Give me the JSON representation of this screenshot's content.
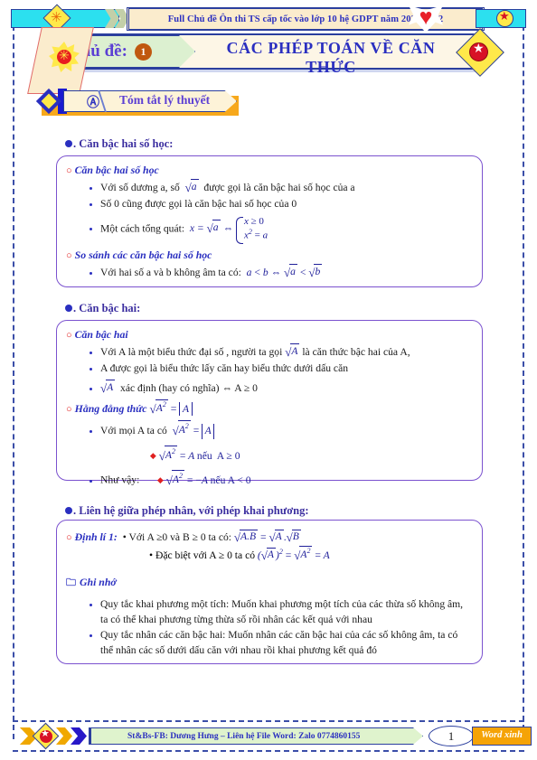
{
  "header": {
    "banner_text": "Full Chủ đề Ôn thi TS cấp tốc vào lớp 10 hệ GDPT năm 2021-2022",
    "heart_icon": "heart-icon",
    "left_burst_icon": "sunburst-icon",
    "right_star_icon": "flower-star-icon"
  },
  "title": {
    "prefix": "Chủ đề:",
    "number": "1",
    "main": "CÁC PHÉP TOÁN VỀ CĂN THỨC"
  },
  "section_a": {
    "letter": "Ⓐ",
    "label": "Tóm tắt lý thuyết"
  },
  "sections": [
    {
      "heading": ". Căn bậc hai số học:",
      "blocks": [
        {
          "marker": "○",
          "title": "Căn bậc hai số học",
          "items": [
            "Với số dương a, số √a được gọi là căn bậc hai số học của a",
            "Số 0 cũng được gọi là căn bậc hai số học của 0",
            "Một cách tổng quát: x = √a ⇔ { x ≥ 0 ; x² = a }"
          ]
        },
        {
          "marker": "○",
          "title": "So sánh các căn bậc hai số học",
          "items": [
            "Với hai số a và b không âm ta có: a < b ⇔ √a < √b"
          ]
        }
      ]
    },
    {
      "heading": ". Căn bậc hai:",
      "blocks": [
        {
          "marker": "○",
          "title": "Căn bậc hai",
          "items": [
            "Với A là một biểu thức đại số , người ta gọi √A là căn thức bậc hai của A,",
            "A được gọi là biểu thức lấy căn hay biểu thức dưới dấu căn",
            "√A xác định (hay có nghĩa) ⇔ A ≥ 0"
          ]
        },
        {
          "marker": "○",
          "title": "Hằng đẳng thức √A² = |A|",
          "items": [
            "Với mọi A ta có √A² = |A|",
            "Như vậy:  • √A² = A nếu A ≥ 0   • √A² = −A nếu A < 0"
          ]
        }
      ]
    },
    {
      "heading": ". Liên hệ giữa phép nhân, với phép khai phương:",
      "blocks": [
        {
          "marker": "○",
          "title": "Định lí 1:",
          "items": [
            "• Với A ≥0 và B ≥ 0 ta có: √A.B = √A.√B",
            "• Đặc biệt với A ≥ 0 ta có (√A)² = √A² = A"
          ]
        },
        {
          "marker": "folder",
          "title": "Ghi nhớ",
          "items": [
            "Quy tắc khai phương một tích: Muốn khai phương một tích của các thừa số không âm, ta có thể khai phương từng thừa số rồi nhân các kết quả với nhau",
            "Quy tắc nhân các căn bậc hai: Muốn nhân các căn bậc hai của các số không âm, ta có thể nhân các số dưới dấu căn với nhau rồi khai phương kết quả đó"
          ]
        }
      ]
    }
  ],
  "footer": {
    "credit": "St&Bs-FB: Dương Hưng – Liên hệ File Word: Zalo 0774860155",
    "page_number": "1",
    "badge": "Word xinh"
  },
  "colors": {
    "accent_blue": "#2a2fc0",
    "purple": "#5b3fd4",
    "box_border": "#7b52cf",
    "red_ring": "#e02020",
    "orange_badge": "#f5a306",
    "cyan": "#2ce0ef",
    "yellow": "#ffe94a"
  }
}
